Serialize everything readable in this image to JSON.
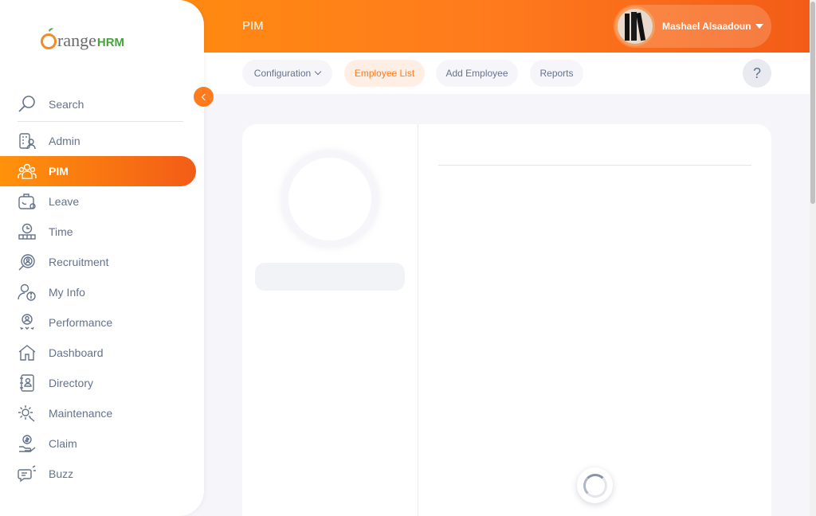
{
  "app": {
    "logo_text": "range",
    "logo_hrm": "HRM",
    "module_title": "PIM"
  },
  "user": {
    "name": "Mashael Alsaadoun"
  },
  "subnav": {
    "items": [
      {
        "label": "Configuration",
        "has_dropdown": true
      },
      {
        "label": "Employee List",
        "active": true
      },
      {
        "label": "Add Employee"
      },
      {
        "label": "Reports"
      }
    ],
    "help_label": "?"
  },
  "sidebar": {
    "search_label": "Search",
    "items": [
      {
        "label": "Admin",
        "icon": "admin-icon"
      },
      {
        "label": "PIM",
        "icon": "pim-icon",
        "active": true
      },
      {
        "label": "Leave",
        "icon": "leave-icon"
      },
      {
        "label": "Time",
        "icon": "time-icon"
      },
      {
        "label": "Recruitment",
        "icon": "recruitment-icon"
      },
      {
        "label": "My Info",
        "icon": "my-info-icon"
      },
      {
        "label": "Performance",
        "icon": "performance-icon"
      },
      {
        "label": "Dashboard",
        "icon": "dashboard-icon"
      },
      {
        "label": "Directory",
        "icon": "directory-icon"
      },
      {
        "label": "Maintenance",
        "icon": "maintenance-icon"
      },
      {
        "label": "Claim",
        "icon": "claim-icon"
      },
      {
        "label": "Buzz",
        "icon": "buzz-icon"
      }
    ]
  },
  "colors": {
    "accent": "#ff7b1d",
    "text": "#64728c"
  }
}
